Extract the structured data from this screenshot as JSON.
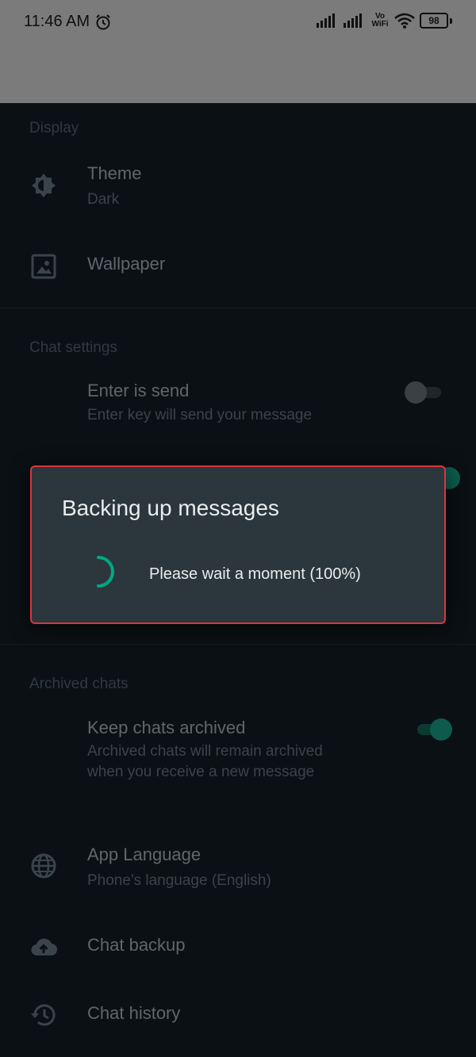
{
  "status_bar": {
    "time": "11:46 AM",
    "vowifi_top": "Vo",
    "vowifi_bottom": "WiFi",
    "battery": "98"
  },
  "display": {
    "header": "Display",
    "theme_title": "Theme",
    "theme_value": "Dark",
    "wallpaper_title": "Wallpaper"
  },
  "chat_settings": {
    "header": "Chat settings",
    "enter_send_title": "Enter is send",
    "enter_send_sub": "Enter key will send your message"
  },
  "archived": {
    "header": "Archived chats",
    "keep_title": "Keep chats archived",
    "keep_sub_line1": "Archived chats will remain archived",
    "keep_sub_line2": "when you receive a new message"
  },
  "other": {
    "language_title": "App Language",
    "language_value": "Phone's language (English)",
    "backup_title": "Chat backup",
    "history_title": "Chat history"
  },
  "dialog": {
    "title": "Backing up messages",
    "message": "Please wait a moment (100%)"
  },
  "colors": {
    "accent": "#00a884",
    "dialog_bg": "#2b373d",
    "highlight_border": "#d8353f"
  }
}
